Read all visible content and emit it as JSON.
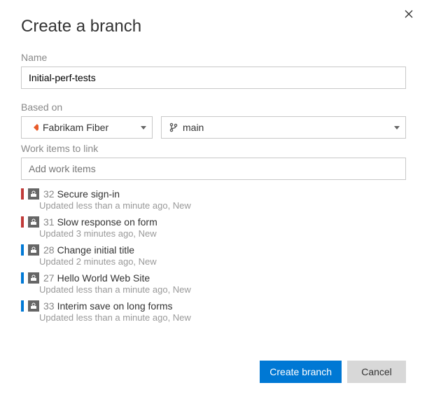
{
  "dialog": {
    "title": "Create a branch",
    "name_label": "Name",
    "name_value": "Initial-perf-tests",
    "based_on_label": "Based on",
    "repo_value": "Fabrikam Fiber",
    "branch_value": "main",
    "work_items_label": "Work items to link",
    "work_items_placeholder": "Add work items"
  },
  "work_items": [
    {
      "color": "red",
      "id": "32",
      "title": "Secure sign-in",
      "sub": "Updated less than a minute ago, New"
    },
    {
      "color": "red",
      "id": "31",
      "title": "Slow response on form",
      "sub": "Updated 3 minutes ago, New"
    },
    {
      "color": "blue",
      "id": "28",
      "title": "Change initial title",
      "sub": "Updated 2 minutes ago, New"
    },
    {
      "color": "blue",
      "id": "27",
      "title": "Hello World Web Site",
      "sub": "Updated less than a minute ago, New"
    },
    {
      "color": "blue",
      "id": "33",
      "title": "Interim save on long forms",
      "sub": "Updated less than a minute ago, New"
    }
  ],
  "buttons": {
    "create": "Create branch",
    "cancel": "Cancel"
  }
}
